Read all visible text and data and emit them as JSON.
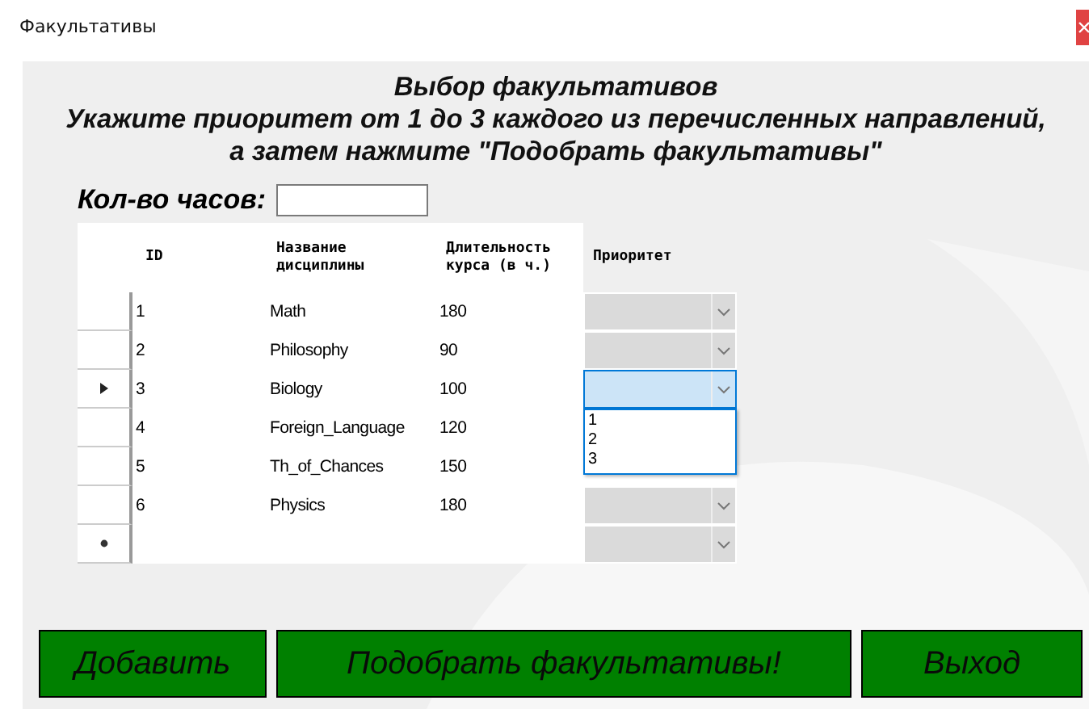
{
  "window": {
    "title": "Факультативы"
  },
  "heading": {
    "title": "Выбор факультативов",
    "instruction_line_1": "Укажите приоритет от 1 до 3 каждого из перечисленных направлений,",
    "instruction_line_2": "а затем нажмите \"Подобрать факультативы\""
  },
  "hours": {
    "label": "Кол-во часов:"
  },
  "table": {
    "columns": [
      "ID",
      "Название дисциплины",
      "Длительность курса (в ч.)",
      "Приоритет"
    ],
    "rows": [
      {
        "kind": "data",
        "selected": false,
        "id": "1",
        "name": "Math",
        "duration": "180"
      },
      {
        "kind": "data",
        "selected": false,
        "id": "2",
        "name": "Philosophy",
        "duration": "90"
      },
      {
        "kind": "data",
        "selected": true,
        "id": "3",
        "name": "Biology",
        "duration": "100",
        "dropdown_open": true,
        "options": [
          "1",
          "2",
          "3"
        ]
      },
      {
        "kind": "data",
        "selected": false,
        "id": "4",
        "name": "Foreign_Language",
        "duration": "120"
      },
      {
        "kind": "data",
        "selected": false,
        "id": "5",
        "name": "Th_of_Chances",
        "duration": "150"
      },
      {
        "kind": "data",
        "selected": false,
        "id": "6",
        "name": "Physics",
        "duration": "180"
      },
      {
        "kind": "new",
        "selected": false
      }
    ]
  },
  "buttons": [
    "Добавить",
    "Подобрать факультативы!",
    "Выход"
  ]
}
